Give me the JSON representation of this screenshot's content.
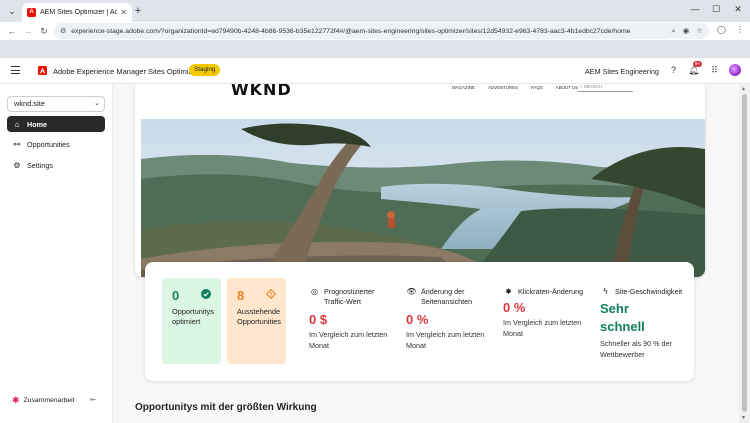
{
  "browser": {
    "tab_title": "AEM Sites Optimizer | Adobe E",
    "url": "experience-stage.adobe.com/?organizationId=ed79490b-4248-4b86-9536-b35e122772f4#/@aem-sites-engineering/sites-optimizer/sites/12d54932-e963-4783-aac3-4b1edbc27cde/home"
  },
  "header": {
    "app_name": "Adobe Experience Manager Sites Optimizer",
    "env_badge": "Staging",
    "org_name": "AEM Sites Engineering",
    "notification_count": "9+"
  },
  "sidebar": {
    "site_picker_value": "wknd.site",
    "items": [
      {
        "label": "Home",
        "icon": "home-icon",
        "active": true
      },
      {
        "label": "Opportunities",
        "icon": "opportunities-icon",
        "active": false
      },
      {
        "label": "Settings",
        "icon": "gear-icon",
        "active": false
      }
    ],
    "footer_label": "Zusammenarbeit"
  },
  "preview": {
    "logo": "WKND",
    "nav": [
      "MAGAZINE",
      "ADVENTURES",
      "FAQS",
      "ABOUT US"
    ],
    "search_placeholder": "SEARCH"
  },
  "stats": {
    "optimized": {
      "value": "0",
      "label": "Opportunitys optimiert"
    },
    "pending": {
      "value": "8",
      "label": "Ausstehende Opportunities"
    }
  },
  "metrics": [
    {
      "icon": "target-icon",
      "title": "Prognostizierter Traffic-Wert",
      "value": "0 $",
      "sub": "Im Vergleich zum letzten Monat"
    },
    {
      "icon": "eye-icon",
      "title": "Änderung der Seitenansichten",
      "value": "0 %",
      "sub": "Im Vergleich zum letzten Monat"
    },
    {
      "icon": "click-icon",
      "title": "Klickraten-Änderung",
      "value": "0 %",
      "sub": "Im Vergleich zum letzten Monat"
    },
    {
      "icon": "lightning-icon",
      "title": "Site-Geschwindigkeit",
      "value": "Sehr schnell",
      "sub": "Schneller als 90 % der Wettbewerber"
    }
  ],
  "section_title": "Opportunitys mit der größten Wirkung",
  "colors": {
    "accent_green": "#12805c",
    "accent_red": "#d7373f",
    "accent_orange": "#e68619",
    "badge_yellow": "#f3c900"
  }
}
